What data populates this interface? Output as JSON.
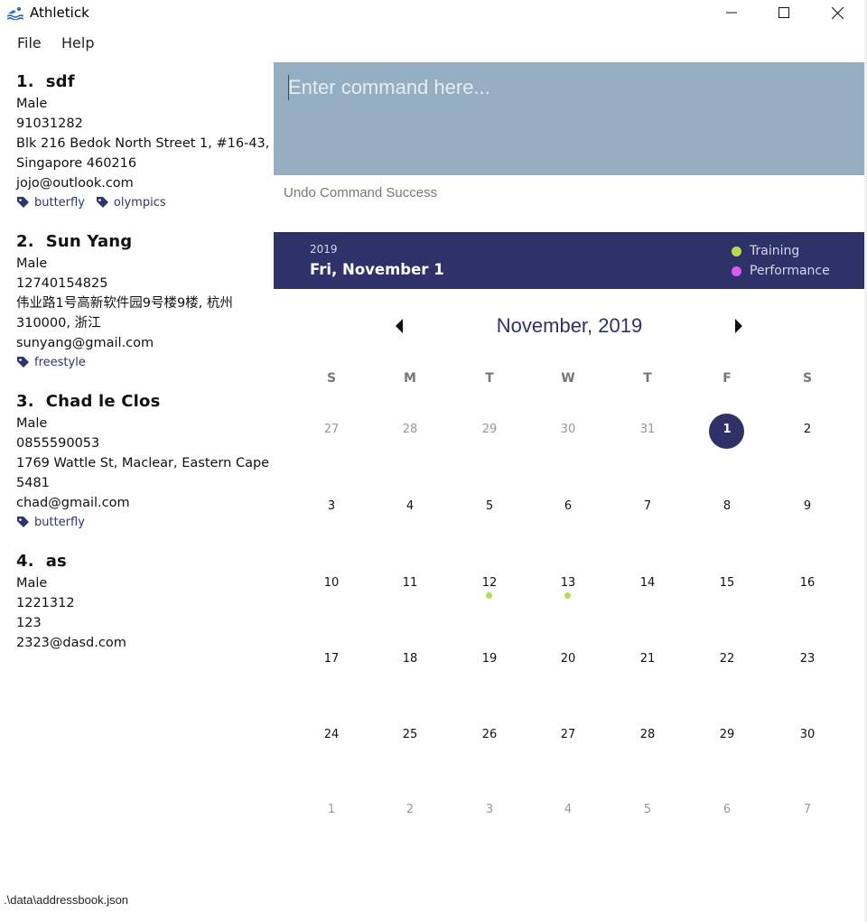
{
  "window": {
    "title": "Athletick"
  },
  "menu": {
    "file": "File",
    "help": "Help"
  },
  "persons": [
    {
      "index": "1.",
      "name": "sdf",
      "gender": "Male",
      "phone": "91031282",
      "address": "Blk 216 Bedok North Street 1, #16-43, Singapore 460216",
      "email": "jojo@outlook.com",
      "tags": [
        "butterfly",
        "olympics"
      ]
    },
    {
      "index": "2.",
      "name": "Sun Yang",
      "gender": "Male",
      "phone": "12740154825",
      "address": "伟业路1号高新软件园9号楼9楼, 杭州 310000, 浙江",
      "email": "sunyang@gmail.com",
      "tags": [
        "freestyle"
      ]
    },
    {
      "index": "3.",
      "name": "Chad le Clos",
      "gender": "Male",
      "phone": "0855590053",
      "address": "1769 Wattle St, Maclear, Eastern Cape 5481",
      "email": "chad@gmail.com",
      "tags": [
        "butterfly"
      ]
    },
    {
      "index": "4.",
      "name": "as",
      "gender": "Male",
      "phone": "1221312",
      "address": "123",
      "email": "2323@dasd.com",
      "tags": []
    }
  ],
  "command": {
    "placeholder": "Enter command here...",
    "value": ""
  },
  "result": {
    "message": "Undo Command Success"
  },
  "calendar": {
    "year": "2019",
    "selected_date": "Fri, November 1",
    "legend": [
      {
        "label": "Training",
        "color": "#b7dc4e"
      },
      {
        "label": "Performance",
        "color": "#d95cf0"
      }
    ],
    "month_title": "November, 2019",
    "weekdays": [
      "S",
      "M",
      "T",
      "W",
      "T",
      "F",
      "S"
    ],
    "weeks": [
      [
        "27",
        "28",
        "29",
        "30",
        "31",
        "1",
        "2"
      ],
      [
        "3",
        "4",
        "5",
        "6",
        "7",
        "8",
        "9"
      ],
      [
        "10",
        "11",
        "12",
        "13",
        "14",
        "15",
        "16"
      ],
      [
        "17",
        "18",
        "19",
        "20",
        "21",
        "22",
        "23"
      ],
      [
        "24",
        "25",
        "26",
        "27",
        "28",
        "29",
        "30"
      ],
      [
        "1",
        "2",
        "3",
        "4",
        "5",
        "6",
        "7"
      ]
    ],
    "muted_cells": [
      [
        0,
        0
      ],
      [
        0,
        1
      ],
      [
        0,
        2
      ],
      [
        0,
        3
      ],
      [
        0,
        4
      ],
      [
        5,
        0
      ],
      [
        5,
        1
      ],
      [
        5,
        2
      ],
      [
        5,
        3
      ],
      [
        5,
        4
      ],
      [
        5,
        5
      ],
      [
        5,
        6
      ]
    ],
    "today_cell": [
      0,
      5
    ],
    "training_days": [
      [
        2,
        2
      ],
      [
        2,
        3
      ]
    ]
  },
  "status": {
    "path": ".\\data\\addressbook.json"
  }
}
